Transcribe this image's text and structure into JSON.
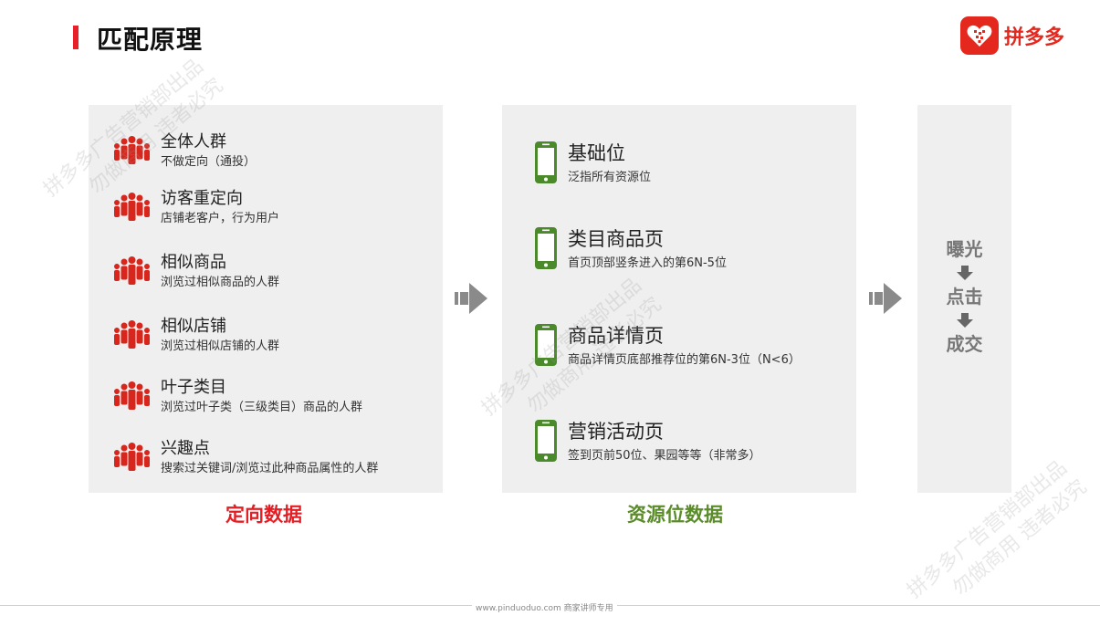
{
  "header": {
    "title": "匹配原理"
  },
  "logo": {
    "text": "拼多多"
  },
  "targeting": {
    "caption": "定向数据",
    "items": [
      {
        "title": "全体人群",
        "desc": "不做定向（通投）"
      },
      {
        "title": "访客重定向",
        "desc": "店铺老客户，行为用户"
      },
      {
        "title": "相似商品",
        "desc": "浏览过相似商品的人群"
      },
      {
        "title": "相似店铺",
        "desc": "浏览过相似店铺的人群"
      },
      {
        "title": "叶子类目",
        "desc": "浏览过叶子类（三级类目）商品的人群"
      },
      {
        "title": "兴趣点",
        "desc": "搜索过关键词/浏览过此种商品属性的人群"
      }
    ]
  },
  "resources": {
    "caption": "资源位数据",
    "items": [
      {
        "title": "基础位",
        "desc": "泛指所有资源位"
      },
      {
        "title": "类目商品页",
        "desc": "首页顶部竖条进入的第6N-5位"
      },
      {
        "title": "商品详情页",
        "desc": "商品详情页底部推荐位的第6N-3位（N<6）"
      },
      {
        "title": "营销活动页",
        "desc": "签到页前50位、果园等等（非常多）"
      }
    ]
  },
  "funnel": {
    "steps": [
      "曝光",
      "点击",
      "成交"
    ]
  },
  "watermark": {
    "line1": "拼多多广告营销部出品",
    "line2": "勿做商用 违者必究"
  },
  "footer": {
    "text": "www.pinduoduo.com 商家讲师专用"
  },
  "colors": {
    "accent_red": "#e31e24",
    "accent_green": "#5b8c2a",
    "panel_bg": "#efefef"
  },
  "icons": {
    "targeting": "people-group-icon",
    "resource": "mobile-phone-icon",
    "flow": "arrow-right-icon",
    "funnel_step": "arrow-down-icon"
  }
}
